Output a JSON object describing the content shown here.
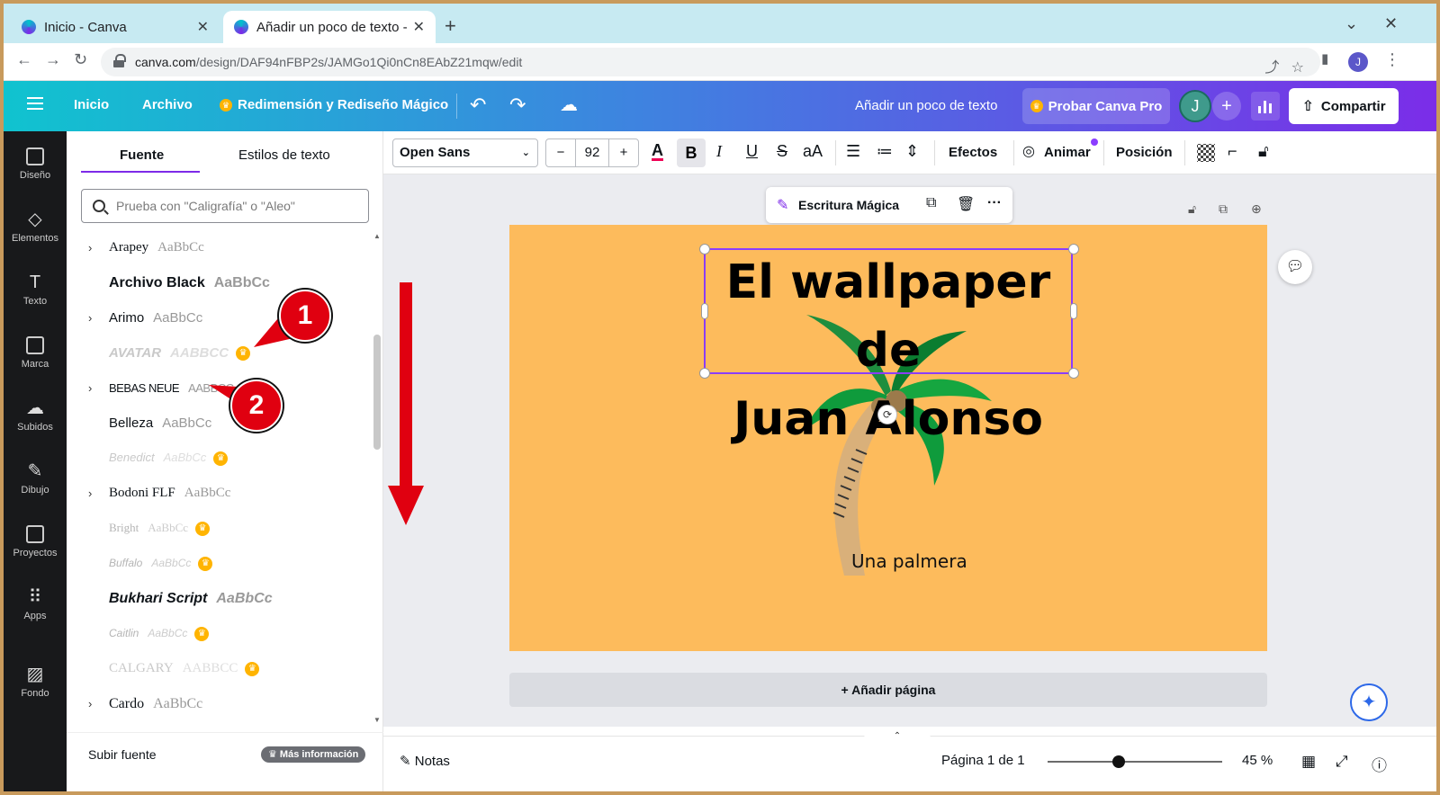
{
  "browser": {
    "tabs": [
      {
        "title": "Inicio - Canva",
        "active": false
      },
      {
        "title": "Añadir un poco de texto -",
        "active": true
      }
    ],
    "url_host": "canva.com",
    "url_path": "/design/DAF94nFBP2s/JAMGo1Qi0nCn8EAbZ21mqw/edit",
    "profile_initial": "J"
  },
  "header": {
    "inicio": "Inicio",
    "archivo": "Archivo",
    "magic": "Redimensión y Rediseño Mágico",
    "doc_title": "Añadir un poco de texto",
    "try_pro": "Probar Canva Pro",
    "avatar": "J",
    "share": "Compartir"
  },
  "rail": [
    "Diseño",
    "Elementos",
    "Texto",
    "Marca",
    "Subidos",
    "Dibujo",
    "Proyectos",
    "Apps",
    "Fondo"
  ],
  "panel": {
    "tab_font": "Fuente",
    "tab_styles": "Estilos de texto",
    "search_placeholder": "Prueba con \"Caligrafía\" o \"Aleo\"",
    "fonts": [
      {
        "name": "Arapey",
        "sample": "AaBbCc",
        "expand": true,
        "pro": false
      },
      {
        "name": "Archivo Black",
        "sample": "AaBbCc",
        "expand": false,
        "pro": false
      },
      {
        "name": "Arimo",
        "sample": "AaBbCc",
        "expand": true,
        "pro": false
      },
      {
        "name": "AVATAR",
        "sample": "AABBCC",
        "expand": false,
        "pro": true
      },
      {
        "name": "BEBAS NEUE",
        "sample": "AABBCC",
        "expand": true,
        "pro": false
      },
      {
        "name": "Belleza",
        "sample": "AaBbCc",
        "expand": false,
        "pro": false
      },
      {
        "name": "Benedict",
        "sample": "AaBbCc",
        "expand": false,
        "pro": true
      },
      {
        "name": "Bodoni FLF",
        "sample": "AaBbCc",
        "expand": true,
        "pro": false
      },
      {
        "name": "Bright",
        "sample": "AaBbCc",
        "expand": false,
        "pro": true
      },
      {
        "name": "Buffalo",
        "sample": "AaBbCc",
        "expand": false,
        "pro": true
      },
      {
        "name": "Bukhari Script",
        "sample": "AaBbCc",
        "expand": false,
        "pro": false
      },
      {
        "name": "Caitlin",
        "sample": "AaBbCc",
        "expand": false,
        "pro": true
      },
      {
        "name": "CALGARY",
        "sample": "AABBCC",
        "expand": false,
        "pro": true
      },
      {
        "name": "Cardo",
        "sample": "AaBbCc",
        "expand": true,
        "pro": false
      }
    ],
    "upload_font": "Subir fuente",
    "more_info": "Más información"
  },
  "toolbar": {
    "font": "Open Sans",
    "size": "92",
    "effects": "Efectos",
    "animate": "Animar",
    "position": "Posición"
  },
  "canvas": {
    "magic_write": "Escritura Mágica",
    "title_line1": "El wallpaper de",
    "title_line2": "Juan Alonso",
    "caption": "Una palmera",
    "add_page": "+ Añadir página",
    "background_color": "#FDBB5C"
  },
  "bottom": {
    "notes": "Notas",
    "page_info": "Página 1 de 1",
    "zoom": "45 %",
    "zoom_level": 0.45
  },
  "annotations": {
    "badge1": "1",
    "badge2": "2"
  }
}
